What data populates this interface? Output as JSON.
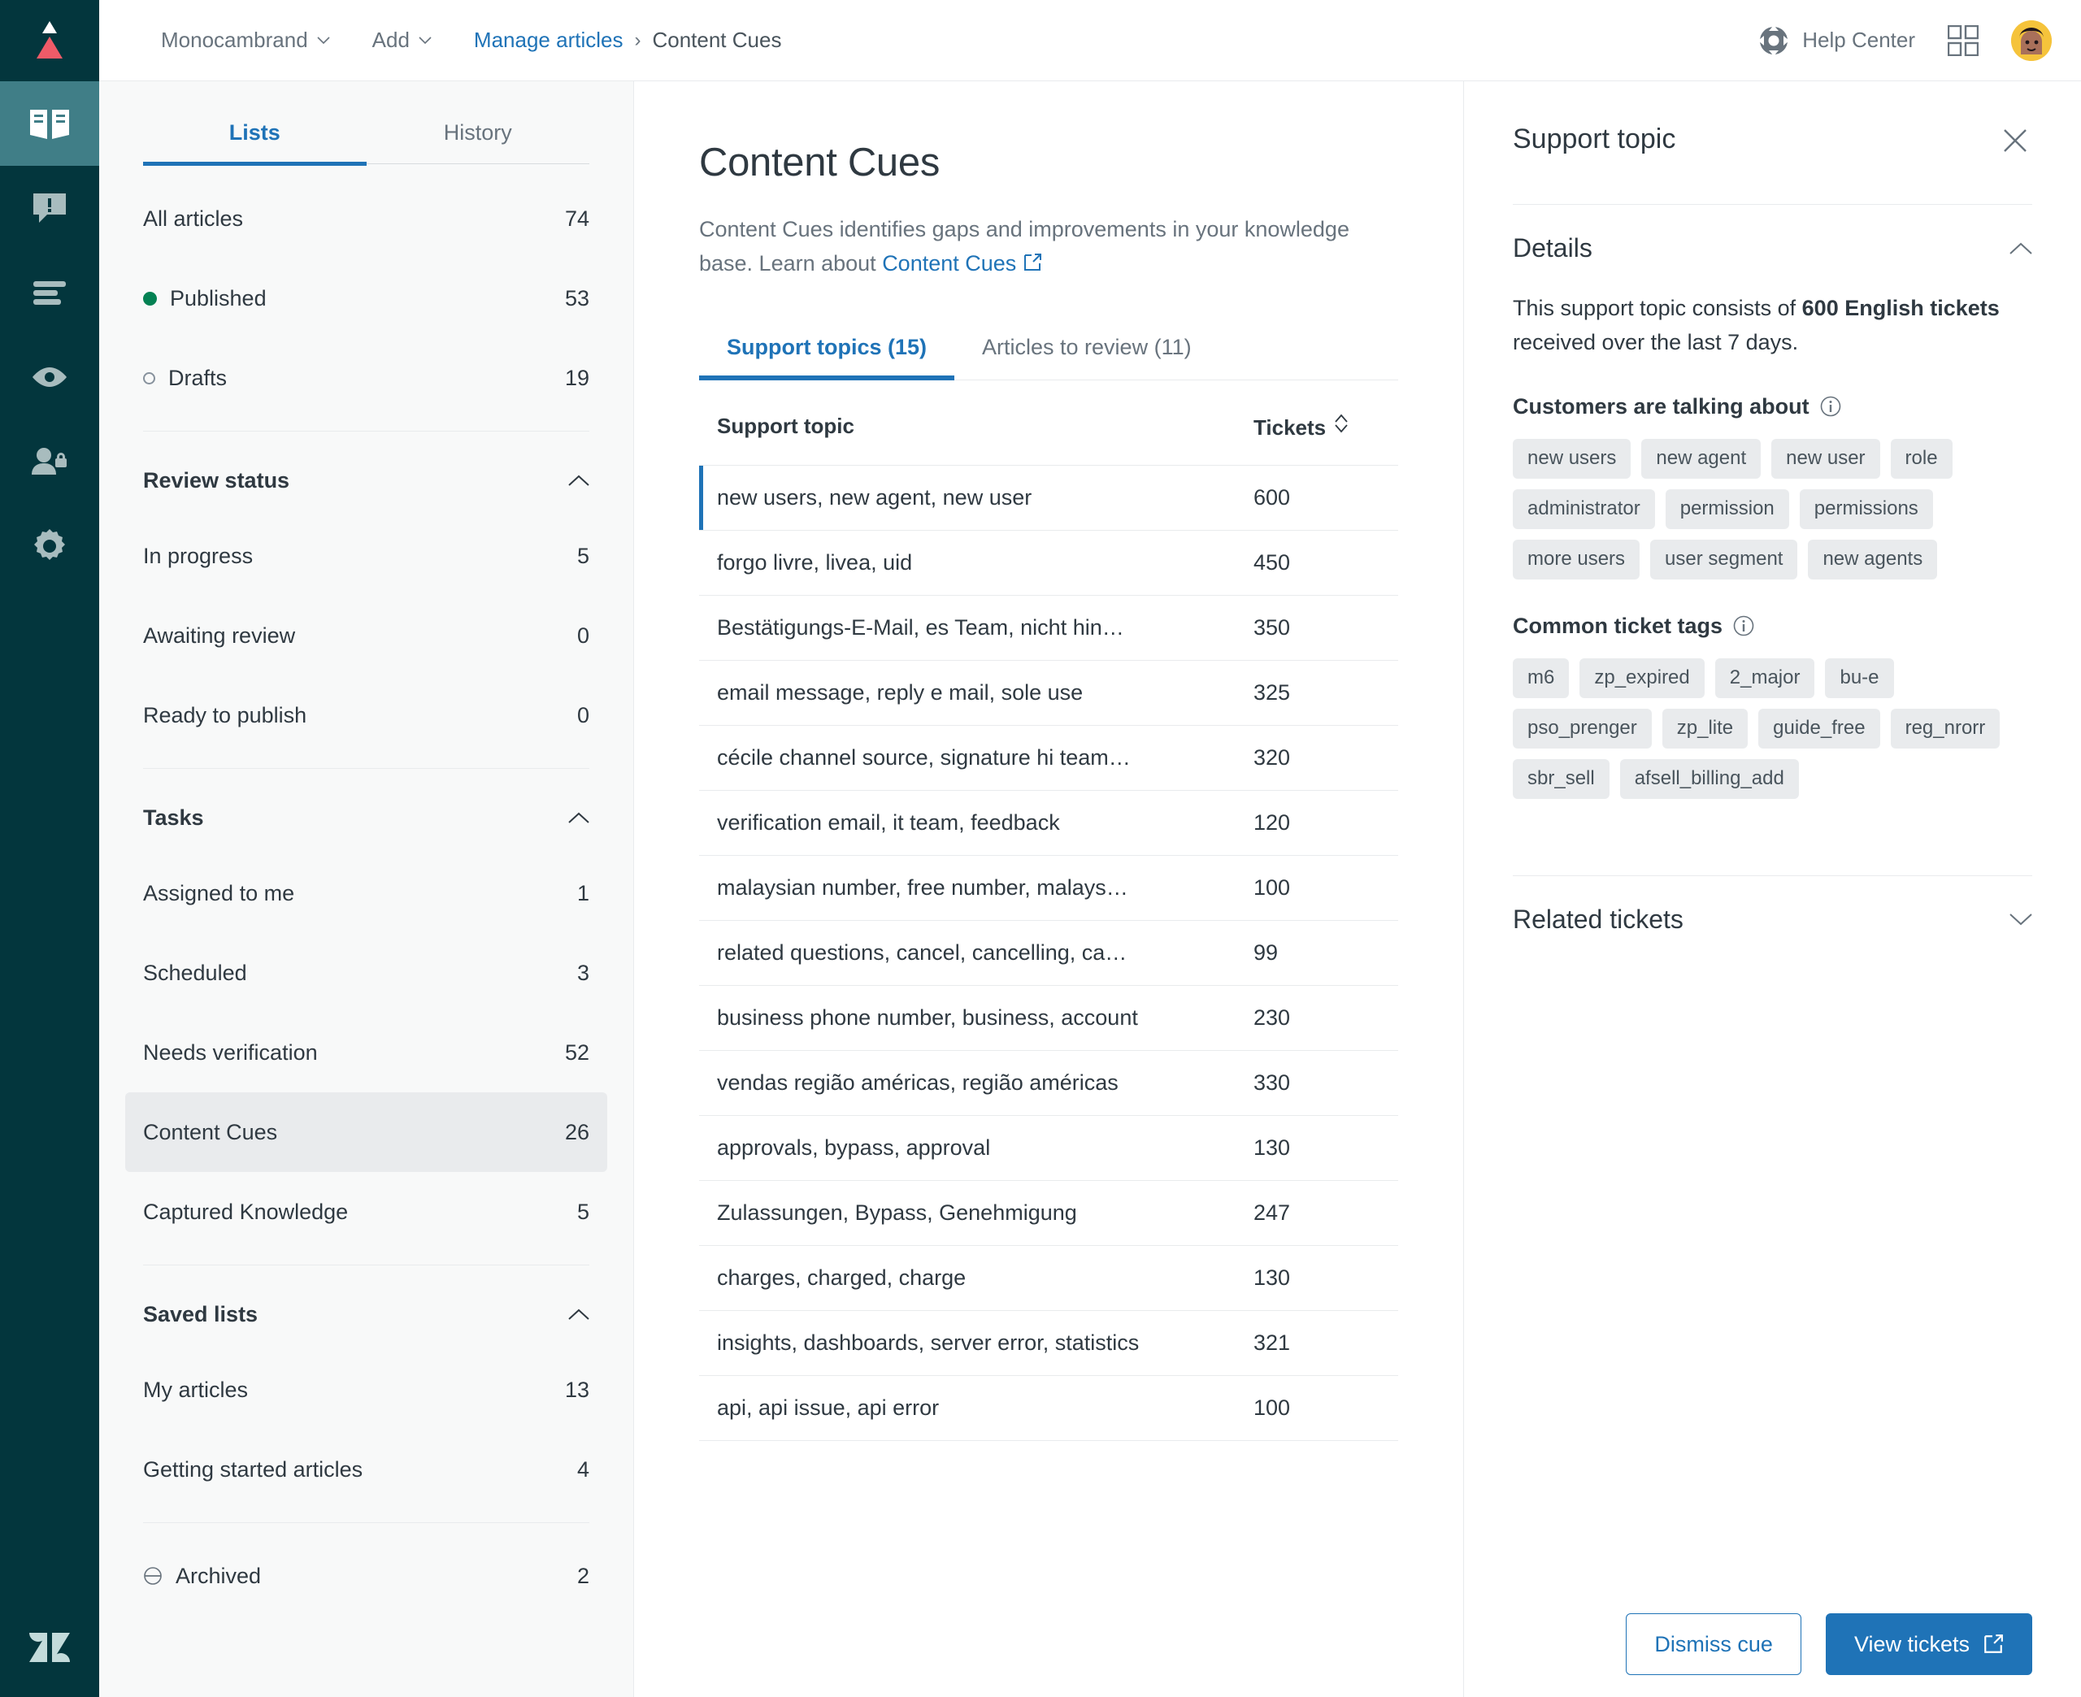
{
  "topbar": {
    "brand_menu": "Monocambrand",
    "add_menu": "Add",
    "breadcrumb_link": "Manage articles",
    "breadcrumb_sep": "›",
    "breadcrumb_current": "Content Cues",
    "help_center": "Help Center"
  },
  "rail": {
    "items": [
      {
        "name": "knowledge-icon",
        "active": true
      },
      {
        "name": "feedback-icon",
        "active": false
      },
      {
        "name": "lists-icon",
        "active": false
      },
      {
        "name": "views-icon",
        "active": false
      },
      {
        "name": "permissions-icon",
        "active": false
      },
      {
        "name": "settings-icon",
        "active": false
      }
    ]
  },
  "sidebar": {
    "tabs": [
      {
        "label": "Lists",
        "active": true
      },
      {
        "label": "History",
        "active": false
      }
    ],
    "top_items": [
      {
        "label": "All articles",
        "count": "74",
        "marker": "none"
      },
      {
        "label": "Published",
        "count": "53",
        "marker": "filled"
      },
      {
        "label": "Drafts",
        "count": "19",
        "marker": "hollow"
      }
    ],
    "sections": [
      {
        "title": "Review status",
        "items": [
          {
            "label": "In progress",
            "count": "5"
          },
          {
            "label": "Awaiting review",
            "count": "0"
          },
          {
            "label": "Ready to publish",
            "count": "0"
          }
        ]
      },
      {
        "title": "Tasks",
        "items": [
          {
            "label": "Assigned to me",
            "count": "1"
          },
          {
            "label": "Scheduled",
            "count": "3"
          },
          {
            "label": "Needs verification",
            "count": "52"
          },
          {
            "label": "Content Cues",
            "count": "26",
            "selected": true
          },
          {
            "label": "Captured Knowledge",
            "count": "5"
          }
        ]
      },
      {
        "title": "Saved lists",
        "items": [
          {
            "label": "My articles",
            "count": "13"
          },
          {
            "label": "Getting started articles",
            "count": "4"
          }
        ]
      }
    ],
    "archived": {
      "label": "Archived",
      "count": "2"
    }
  },
  "main": {
    "title": "Content Cues",
    "description_part1": "Content Cues identifies gaps and improvements in your knowledge base. Learn about ",
    "description_link": "Content Cues",
    "tabs": [
      {
        "label": "Support topics (15)",
        "active": true
      },
      {
        "label": "Articles to review (11)",
        "active": false
      }
    ],
    "table": {
      "headers": {
        "topic": "Support topic",
        "tickets": "Tickets"
      },
      "rows": [
        {
          "topic": "new users, new agent, new user",
          "tickets": "600",
          "selected": true
        },
        {
          "topic": "forgo livre, livea, uid",
          "tickets": "450"
        },
        {
          "topic": "Bestätigungs-E-Mail, es Team, nicht hin…",
          "tickets": "350"
        },
        {
          "topic": "email message, reply e mail, sole use",
          "tickets": "325"
        },
        {
          "topic": "cécile channel source, signature hi team…",
          "tickets": "320"
        },
        {
          "topic": "verification email, it team, feedback",
          "tickets": "120"
        },
        {
          "topic": "malaysian number, free number, malays…",
          "tickets": "100"
        },
        {
          "topic": "related questions, cancel, cancelling, ca…",
          "tickets": "99"
        },
        {
          "topic": "business phone number, business, account",
          "tickets": "230"
        },
        {
          "topic": "vendas região américas, região américas",
          "tickets": "330"
        },
        {
          "topic": "approvals, bypass, approval",
          "tickets": "130"
        },
        {
          "topic": "Zulassungen, Bypass, Genehmigung",
          "tickets": "247"
        },
        {
          "topic": "charges, charged, charge",
          "tickets": "130"
        },
        {
          "topic": "insights, dashboards, server error, statistics",
          "tickets": "321"
        },
        {
          "topic": "api, api issue, api error",
          "tickets": "100"
        }
      ]
    }
  },
  "panel": {
    "title": "Support topic",
    "details_heading": "Details",
    "detail_pre": "This support topic consists of ",
    "detail_bold": "600 English tickets",
    "detail_post": " received over the last 7 days.",
    "talking_about_heading": "Customers are talking about",
    "talking_about_tags": [
      "new users",
      "new agent",
      "new user",
      "role",
      "administrator",
      "permission",
      "permissions",
      "more users",
      "user segment",
      "new agents"
    ],
    "ticket_tags_heading": "Common ticket tags",
    "ticket_tags": [
      "m6",
      "zp_expired",
      "2_major",
      "bu-e",
      "pso_prenger",
      "zp_lite",
      "guide_free",
      "reg_nrorr",
      "sbr_sell",
      "afsell_billing_add"
    ],
    "related_tickets_heading": "Related tickets",
    "dismiss_label": "Dismiss cue",
    "view_tickets_label": "View tickets"
  },
  "colors": {
    "rail_bg": "#03363D",
    "rail_active": "#407E87",
    "accent_blue": "#1F73B7",
    "published_green": "#038153",
    "brand_red": "#EF5B68",
    "chip_bg": "#E9EBED"
  }
}
